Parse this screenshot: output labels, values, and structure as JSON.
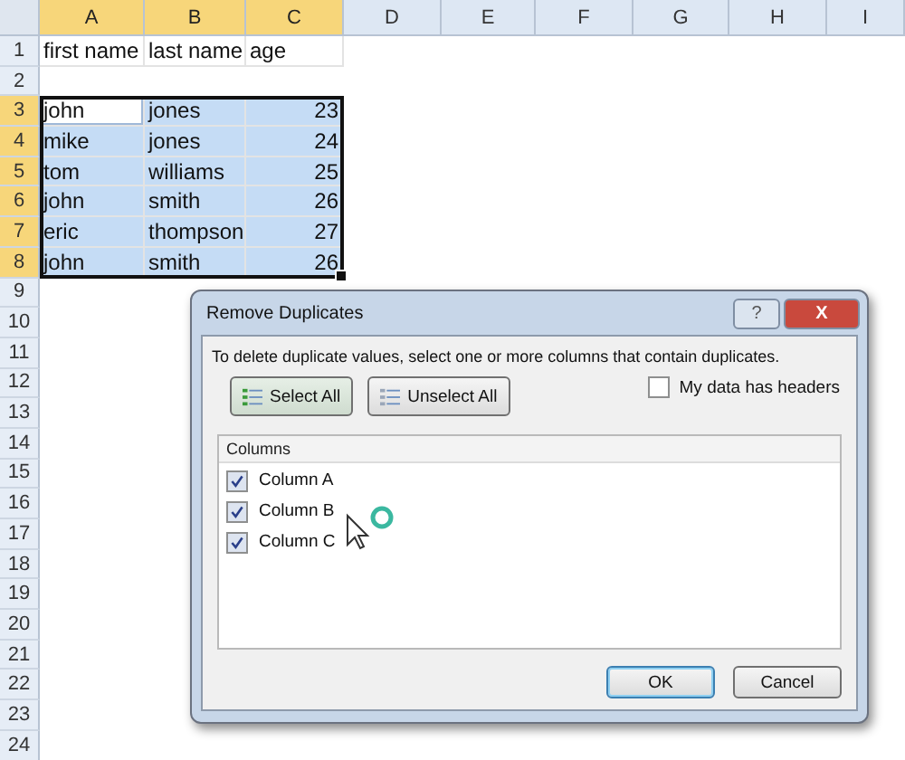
{
  "sheet": {
    "columns": [
      {
        "label": "A",
        "selected": true
      },
      {
        "label": "B",
        "selected": true
      },
      {
        "label": "C",
        "selected": true
      },
      {
        "label": "D",
        "selected": false
      },
      {
        "label": "E",
        "selected": false
      },
      {
        "label": "F",
        "selected": false
      },
      {
        "label": "G",
        "selected": false
      },
      {
        "label": "H",
        "selected": false
      },
      {
        "label": "I",
        "selected": false
      }
    ],
    "rows": [
      {
        "label": "1",
        "selected": false,
        "cells": [
          {
            "text": "first name",
            "kind": "text",
            "selected": false,
            "active": false
          },
          {
            "text": "last name",
            "kind": "text",
            "selected": false,
            "active": false
          },
          {
            "text": "age",
            "kind": "text",
            "selected": false,
            "active": false
          }
        ]
      },
      {
        "label": "2",
        "selected": false,
        "cells": []
      },
      {
        "label": "3",
        "selected": true,
        "cells": [
          {
            "text": "john",
            "kind": "text",
            "selected": true,
            "active": true
          },
          {
            "text": "jones",
            "kind": "text",
            "selected": true,
            "active": false
          },
          {
            "text": "23",
            "kind": "number",
            "selected": true,
            "active": false
          }
        ]
      },
      {
        "label": "4",
        "selected": true,
        "cells": [
          {
            "text": "mike",
            "kind": "text",
            "selected": true,
            "active": false
          },
          {
            "text": "jones",
            "kind": "text",
            "selected": true,
            "active": false
          },
          {
            "text": "24",
            "kind": "number",
            "selected": true,
            "active": false
          }
        ]
      },
      {
        "label": "5",
        "selected": true,
        "cells": [
          {
            "text": "tom",
            "kind": "text",
            "selected": true,
            "active": false
          },
          {
            "text": "williams",
            "kind": "text",
            "selected": true,
            "active": false
          },
          {
            "text": "25",
            "kind": "number",
            "selected": true,
            "active": false
          }
        ]
      },
      {
        "label": "6",
        "selected": true,
        "cells": [
          {
            "text": "john",
            "kind": "text",
            "selected": true,
            "active": false
          },
          {
            "text": "smith",
            "kind": "text",
            "selected": true,
            "active": false
          },
          {
            "text": "26",
            "kind": "number",
            "selected": true,
            "active": false
          }
        ]
      },
      {
        "label": "7",
        "selected": true,
        "cells": [
          {
            "text": "eric",
            "kind": "text",
            "selected": true,
            "active": false
          },
          {
            "text": "thompson",
            "kind": "text",
            "selected": true,
            "active": false
          },
          {
            "text": "27",
            "kind": "number",
            "selected": true,
            "active": false
          }
        ]
      },
      {
        "label": "8",
        "selected": true,
        "cells": [
          {
            "text": "john",
            "kind": "text",
            "selected": true,
            "active": false
          },
          {
            "text": "smith",
            "kind": "text",
            "selected": true,
            "active": false
          },
          {
            "text": "26",
            "kind": "number",
            "selected": true,
            "active": false
          }
        ]
      },
      {
        "label": "9",
        "selected": false,
        "cells": []
      },
      {
        "label": "10",
        "selected": false,
        "cells": []
      },
      {
        "label": "11",
        "selected": false,
        "cells": []
      },
      {
        "label": "12",
        "selected": false,
        "cells": []
      },
      {
        "label": "13",
        "selected": false,
        "cells": []
      },
      {
        "label": "14",
        "selected": false,
        "cells": []
      },
      {
        "label": "15",
        "selected": false,
        "cells": []
      },
      {
        "label": "16",
        "selected": false,
        "cells": []
      },
      {
        "label": "17",
        "selected": false,
        "cells": []
      },
      {
        "label": "18",
        "selected": false,
        "cells": []
      },
      {
        "label": "19",
        "selected": false,
        "cells": []
      },
      {
        "label": "20",
        "selected": false,
        "cells": []
      },
      {
        "label": "21",
        "selected": false,
        "cells": []
      },
      {
        "label": "22",
        "selected": false,
        "cells": []
      },
      {
        "label": "23",
        "selected": false,
        "cells": []
      },
      {
        "label": "24",
        "selected": false,
        "cells": []
      }
    ]
  },
  "dialog": {
    "title": "Remove Duplicates",
    "help": "?",
    "close": "X",
    "instruction": "To delete duplicate values, select one or more columns that contain duplicates.",
    "select_all": "Select All",
    "unselect_all": "Unselect All",
    "headers_checkbox": {
      "label": "My data has headers",
      "checked": false
    },
    "columns_header": "Columns",
    "columns": [
      {
        "label": "Column A",
        "checked": true
      },
      {
        "label": "Column B",
        "checked": true
      },
      {
        "label": "Column C",
        "checked": true
      }
    ],
    "buttons": [
      {
        "label": "OK",
        "default": true
      },
      {
        "label": "Cancel",
        "default": false
      }
    ]
  }
}
